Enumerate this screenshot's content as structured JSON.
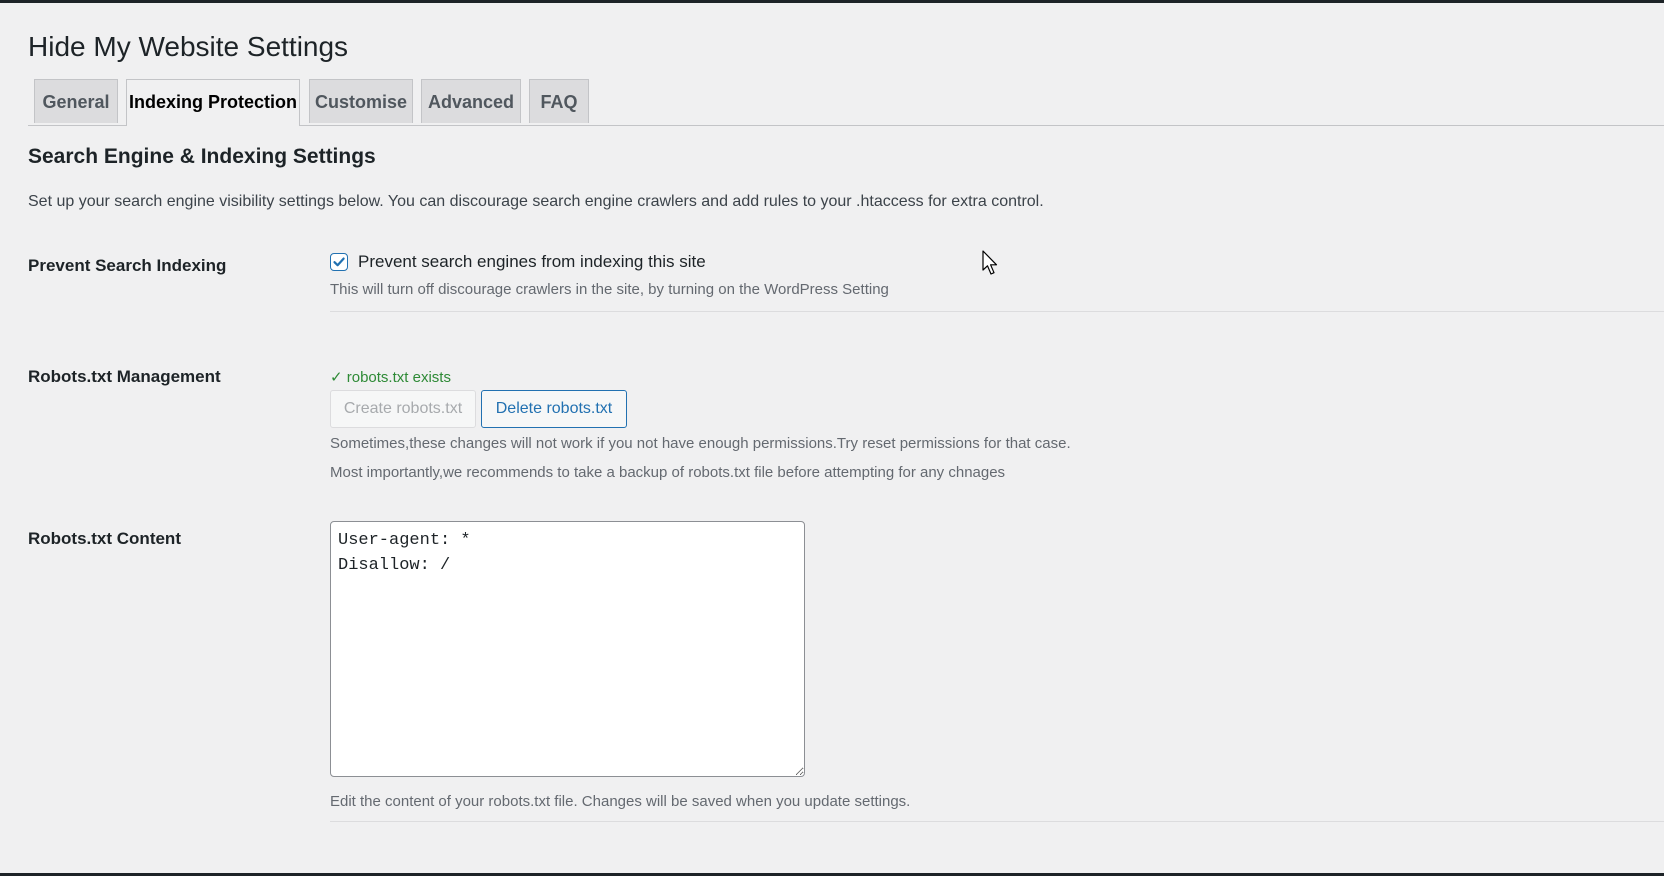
{
  "page": {
    "title": "Hide My Website Settings"
  },
  "tabs": [
    {
      "label": "General",
      "active": false
    },
    {
      "label": "Indexing Protection",
      "active": true
    },
    {
      "label": "Customise",
      "active": false
    },
    {
      "label": "Advanced",
      "active": false
    },
    {
      "label": "FAQ",
      "active": false
    }
  ],
  "section": {
    "title": "Search Engine & Indexing Settings",
    "intro": "Set up your search engine visibility settings below. You can discourage search engine crawlers and add rules to your .htaccess for extra control."
  },
  "prevent_indexing": {
    "label": "Prevent Search Indexing",
    "checkbox_label": "Prevent search engines from indexing this site",
    "checked": true,
    "description": "This will turn off discourage crawlers in the site, by turning on the WordPress Setting"
  },
  "robots_management": {
    "label": "Robots.txt Management",
    "status": "✓ robots.txt exists",
    "create_button": "Create robots.txt",
    "delete_button": "Delete robots.txt",
    "note_1": "Sometimes,these changes will not work if you not have enough permissions.Try reset permissions for that case.",
    "note_2": "Most importantly,we recommends to take a backup of robots.txt file before attempting for any chnages"
  },
  "robots_content": {
    "label": "Robots.txt Content",
    "value": "User-agent: *\nDisallow: /",
    "description": "Edit the content of your robots.txt file. Changes will be saved when you update settings."
  },
  "colors": {
    "accent": "#2271b1",
    "success": "#2e8a36",
    "background": "#f0f0f1",
    "tab_inactive": "#dcdcde"
  },
  "icons": {
    "checkbox_check": "check-icon",
    "cursor": "mouse-pointer-icon"
  }
}
